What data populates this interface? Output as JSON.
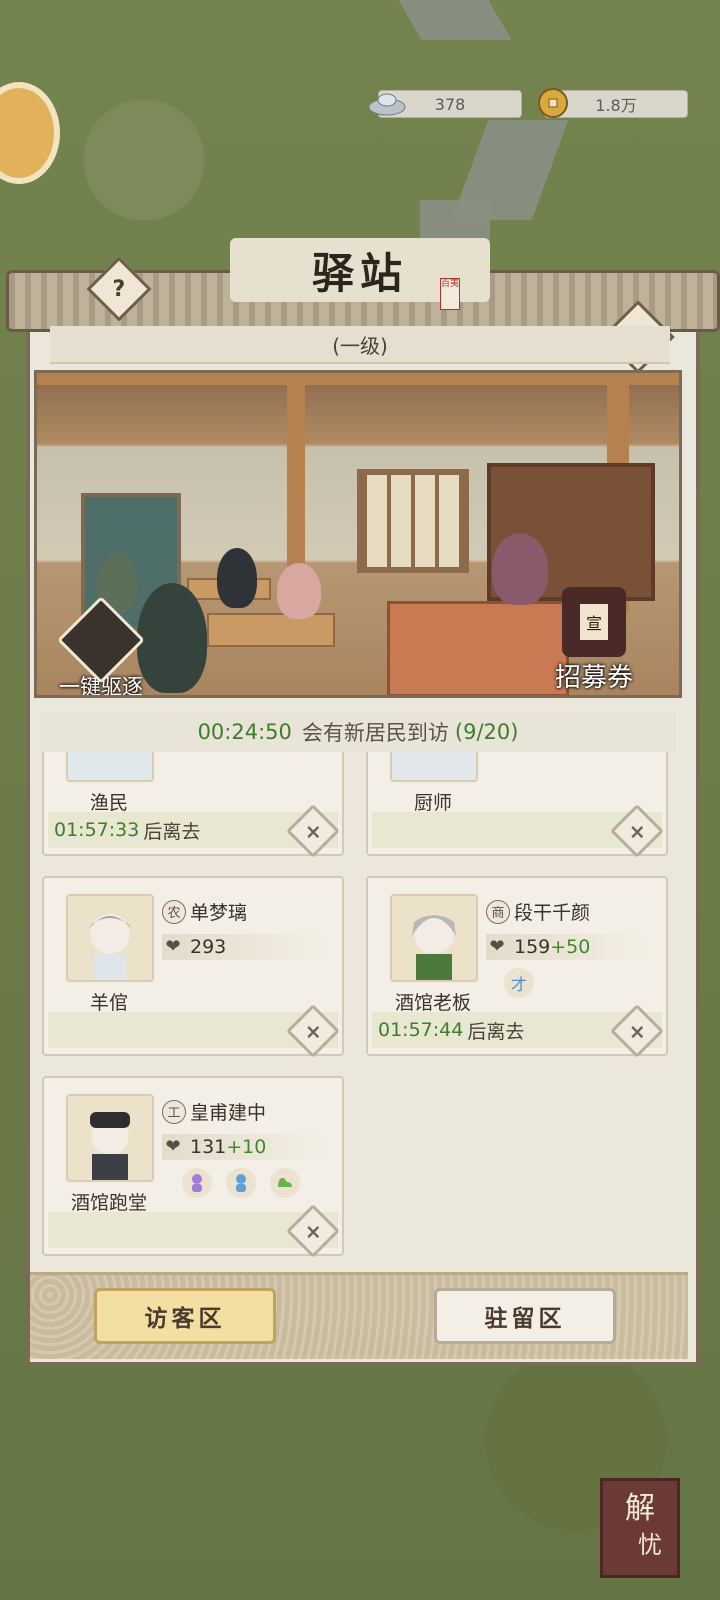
{
  "resources": {
    "silver": {
      "value": "378",
      "icon": "silver-ingot-icon"
    },
    "coins": {
      "value": "1.8万",
      "icon": "copper-coin-icon"
    }
  },
  "panel": {
    "title": "驿站",
    "seal_text": "百夷",
    "level": "(一级)",
    "help_label": "?",
    "scene_buttons": {
      "evict_all": "一键驱逐",
      "recruit": "招募券",
      "recruit_stamp": "宣"
    },
    "timer": {
      "countdown": "00:24:50",
      "message": "会有新居民到访",
      "count": "(9/20)"
    }
  },
  "cards": [
    {
      "role": "渔民",
      "timer": "01:57:33",
      "leave_text": "后离去"
    },
    {
      "role": "厨师"
    },
    {
      "role": "羊倌",
      "badge": "农",
      "name": "单梦璃",
      "power": "293"
    },
    {
      "role": "酒馆老板",
      "badge": "商",
      "name": "段干千颜",
      "power": "159",
      "power_bonus": "+50",
      "trait": "才",
      "timer": "01:57:44",
      "leave_text": "后离去"
    },
    {
      "role": "酒馆跑堂",
      "badge": "工",
      "name": "皇甫建中",
      "power": "131",
      "power_bonus": "+10"
    }
  ],
  "tabs": {
    "visitor": "访客区",
    "resident": "驻留区"
  },
  "corner_seal": {
    "line1": "解",
    "line2": "忧"
  },
  "colors": {
    "accent_green": "#3f7d2c",
    "active_tab": "#f3dfa2",
    "panel_bg": "#ece7dc"
  }
}
